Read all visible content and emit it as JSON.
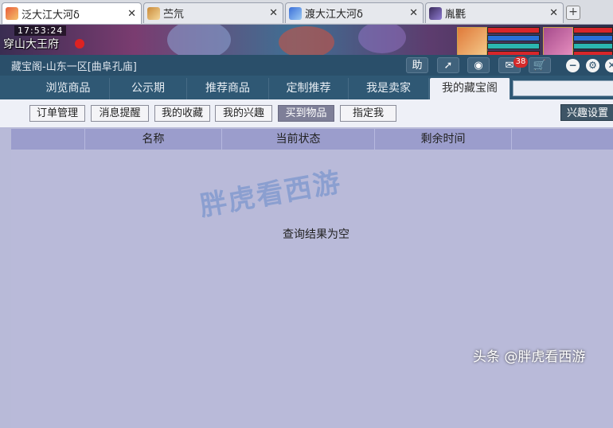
{
  "tabs": [
    {
      "label": "泛大江大河δ",
      "active": true
    },
    {
      "label": "苎氘",
      "active": false
    },
    {
      "label": "渡大江大河δ",
      "active": false
    },
    {
      "label": "胤氍",
      "active": false
    }
  ],
  "scene": {
    "clock": "17:53:24",
    "location": "穿山大王府"
  },
  "window": {
    "title": "藏宝阁-山东一区[曲阜孔庙]",
    "help_button": "助",
    "message_count": "38"
  },
  "nav_tabs": [
    "浏览商品",
    "公示期",
    "推荐商品",
    "定制推荐",
    "我是卖家",
    "我的藏宝阁"
  ],
  "sub_buttons": [
    "订单管理",
    "消息提醒",
    "我的收藏",
    "我的兴趣",
    "买到物品",
    "指定我"
  ],
  "interest_settings": "兴趣设置",
  "table": {
    "headers": [
      "名称",
      "当前状态",
      "剩余时间"
    ],
    "empty_message": "查询结果为空"
  },
  "watermark": "胖虎看西游",
  "signature": "头条 @胖虎看西游",
  "colors": {
    "titlebar": "#2a4f6a",
    "navbar": "#2f5874",
    "table_header": "#9b9dcc",
    "table_body": "#b9bad9"
  }
}
